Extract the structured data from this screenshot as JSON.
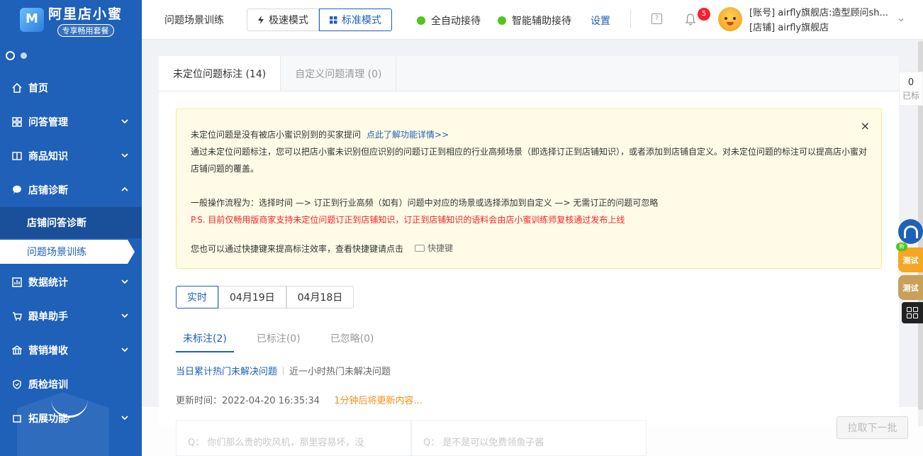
{
  "brand": {
    "title": "阿里店小蜜",
    "badge": "专享畅用套餐"
  },
  "sidebar": {
    "items": [
      {
        "label": "首页"
      },
      {
        "label": "问答管理"
      },
      {
        "label": "商品知识"
      },
      {
        "label": "店铺诊断"
      },
      {
        "label": "店铺问答诊断"
      },
      {
        "label": "问题场景训练"
      },
      {
        "label": "数据统计"
      },
      {
        "label": "跟单助手"
      },
      {
        "label": "营销增收"
      },
      {
        "label": "质检培训"
      },
      {
        "label": "拓展功能"
      }
    ]
  },
  "header": {
    "page_label": "问题场景训练",
    "mode_fast": "极速模式",
    "mode_standard": "标准模式",
    "status_auto": "全自动接待",
    "status_assist": "智能辅助接待",
    "settings": "设置",
    "notification_count": "5",
    "account_line1": "[账号] airfly旗舰店:造型顾问sh...",
    "account_line2": "[店铺] airfly旗舰店"
  },
  "tabs": {
    "unlocated": "未定位问题标注 (14)",
    "custom": "自定义问题清理 (0)"
  },
  "notice": {
    "line1": "未定位问题是没有被店小蜜识别到的买家提问",
    "line1_link": "点此了解功能详情>>",
    "line2": "通过未定位问题标注，您可以把店小蜜未识别但应识别的问题订正到相应的行业高频场景（即选择订正到店铺知识），或者添加到店铺自定义。对未定位问题的标注可以提高店小蜜对店铺问题的覆盖。",
    "line3": "一般操作流程为：选择时间 —> 订正到行业高频（如有）问题中对应的场景或选择添加到自定义 —> 无需订正的问题可忽略",
    "line4": "P.S. 目前仅畅用版商家支持未定位问题订正到店铺知识，订正到店铺知识的语料会由店小蜜训练师复核通过发布上线",
    "line5": "您也可以通过快捷键来提高标注效率，查看快捷键请点击",
    "shortcut": "快捷键",
    "close": "×"
  },
  "dates": [
    "实时",
    "04月19日",
    "04月18日"
  ],
  "status_tabs": [
    "未标注(2)",
    "已标注(0)",
    "已忽略(0)"
  ],
  "hot": {
    "today": "当日累计热门未解决问题",
    "hour": "近一小时热门未解决问题"
  },
  "update": {
    "time": "更新时间：2022-04-20 16:35:34",
    "countdown": "1分钟后将更新内容..."
  },
  "questions": [
    "Q：  你们那么贵的吹风机，那里容易坏，没",
    "Q：  是不是可以免费领鱼子酱"
  ],
  "pull_button": "拉取下一批",
  "counter": {
    "value": "0",
    "label": "已标"
  },
  "floats": {
    "new": "新",
    "test1": "测试",
    "test2": "测试"
  },
  "colors": {
    "primary": "#1f60b8",
    "notice_bg": "#fffbe6",
    "success": "#52c41a",
    "danger": "#f5222d",
    "warning": "#fa8c16"
  }
}
